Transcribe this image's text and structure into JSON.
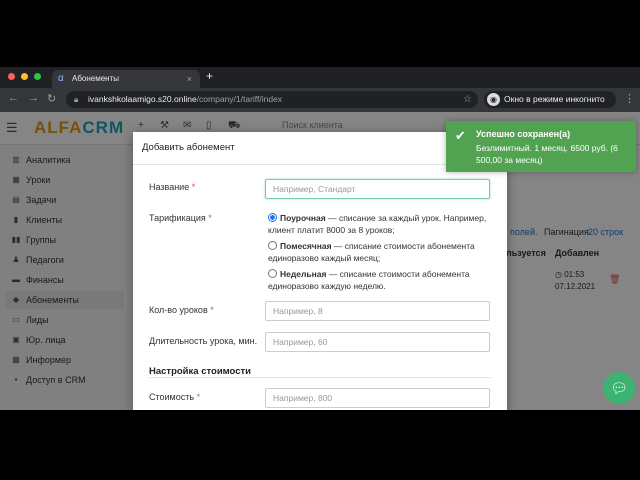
{
  "browser": {
    "tab_title": "Абонементы",
    "tab_close": "×",
    "new_tab": "+",
    "url_host": "ivankshkolaamigo.s20.online",
    "url_path": "/company/1/tariff/index",
    "incognito_label": "Окно в режиме инкогнито"
  },
  "app": {
    "logo_a": "ALFA",
    "logo_b": "CRM",
    "search_placeholder": "Поиск клиента"
  },
  "sidebar": {
    "items": [
      {
        "label": "Аналитика",
        "icon": "bar-chart-icon"
      },
      {
        "label": "Уроки",
        "icon": "calendar-icon"
      },
      {
        "label": "Задачи",
        "icon": "tasks-icon"
      },
      {
        "label": "Клиенты",
        "icon": "user-icon"
      },
      {
        "label": "Группы",
        "icon": "group-icon"
      },
      {
        "label": "Педагоги",
        "icon": "teacher-icon"
      },
      {
        "label": "Финансы",
        "icon": "finance-icon"
      },
      {
        "label": "Абонементы",
        "icon": "tag-icon"
      },
      {
        "label": "Лиды",
        "icon": "leads-icon"
      },
      {
        "label": "Юр. лица",
        "icon": "building-icon"
      },
      {
        "label": "Информер",
        "icon": "info-icon"
      },
      {
        "label": "Доступ в CRM",
        "icon": "lock-icon"
      }
    ]
  },
  "background": {
    "fields_link": "полей.",
    "pagination_label": "Пагинация",
    "pagination_value": "20 строк",
    "col_used": "льзуется",
    "col_added": "Добавлен",
    "row_time": "01:53",
    "row_date": "07.12.2021"
  },
  "modal": {
    "title": "Добавить абонемент",
    "name_label": "Название",
    "name_placeholder": "Например, Стандарт",
    "tariff_label": "Тарификация",
    "option1_bold": "Поурочная",
    "option1_text": " — списание за каждый урок. Например, клиент платит 8000 за 8 уроков;",
    "option2_bold": "Помесячная",
    "option2_text": " — списание стоимости абонемента единоразово каждый месяц;",
    "option3_bold": "Недельная",
    "option3_text": " — списание стоимости абонемента единоразово каждую неделю.",
    "lessons_label": "Кол-во уроков",
    "lessons_placeholder": "Например, 8",
    "duration_label": "Длительность урока, мин.",
    "duration_placeholder": "Например, 60",
    "price_section": "Настройка стоимости",
    "cost_label": "Стоимость",
    "cost_placeholder": "Например, 800",
    "required_mark": "*"
  },
  "toast": {
    "title": "Успешно сохранен(а)",
    "message": "Безлимитный. 1 месяц. 6500 руб. (6 500,00 за месяц)"
  }
}
